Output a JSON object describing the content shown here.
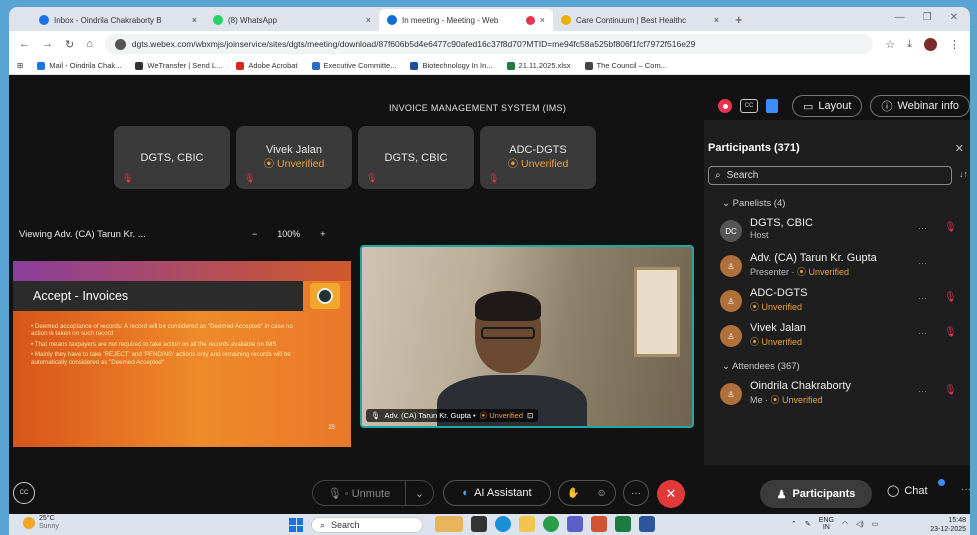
{
  "tabs": [
    {
      "label": "Inbox - Oindrila Chakraborty B",
      "close": "×",
      "icon_color": "#1a73e8",
      "active": false
    },
    {
      "label": "(8) WhatsApp",
      "close": "×",
      "icon_color": "#25d366",
      "active": false
    },
    {
      "label": "In meeting - Meeting - Web",
      "close": "×",
      "icon_color": "#0b6fd1",
      "active": true
    },
    {
      "label": "Care Continuum | Best Healthc",
      "close": "×",
      "icon_color": "#f0b000",
      "active": false
    }
  ],
  "new_tab": "+",
  "url": "dgts.webex.com/wbxmjs/joinservice/sites/dgts/meeting/download/87f606b5d4e6477c90afed16c37f8d70?MTID=me94fc58a525bf806f1fcf7972f516e29",
  "bookmarks": [
    {
      "label": "Mail - Oindrila Chak...",
      "color": "#1a73e8"
    },
    {
      "label": "WeTransfer | Send L...",
      "color": "#333333"
    },
    {
      "label": "Adobe Acrobat",
      "color": "#d7261e"
    },
    {
      "label": "Executive Committe...",
      "color": "#2b6cc4"
    },
    {
      "label": "Biotechnology In In...",
      "color": "#1a4fa0"
    },
    {
      "label": "21.11.2025.xlsx",
      "color": "#1d7a41"
    },
    {
      "label": "The Council – Com...",
      "color": "#444444"
    }
  ],
  "meeting": {
    "title": "INVOICE MANAGEMENT SYSTEM (IMS)",
    "layout_label": "Layout",
    "webinar_label": "Webinar info",
    "cc_label": "CC",
    "tiles": [
      {
        "name": "DGTS, CBIC",
        "status": ""
      },
      {
        "name": "Vivek Jalan",
        "status": "⦿ Unverified"
      },
      {
        "name": "DGTS, CBIC",
        "status": ""
      },
      {
        "name": "ADC-DGTS",
        "status": "⦿ Unverified"
      }
    ],
    "viewing_label": "Viewing Adv. (CA) Tarun Kr. ...",
    "zoom_minus": "−",
    "zoom_level": "100%",
    "zoom_plus": "+",
    "slide": {
      "heading": "Accept - Invoices",
      "bullets": [
        "• Deemed acceptance of records: A record will be considered as \"Deemed Accepted\" in case no action is taken on such record",
        "• That means taxpayers are not required to take action on all the records available on IMS",
        "• Mainly they have to take 'REJECT' and 'PENDING' actions only and remaining records will be automatically considered as \"Deemed Accepted\""
      ],
      "page": "25"
    },
    "video_label": "Adv. (CA) Tarun Kr. Gupta •",
    "video_status": "⦿ Unverified"
  },
  "participants": {
    "title": "Participants (371)",
    "search_placeholder": "Search",
    "panelists_label": "Panelists (4)",
    "attendees_label": "Attendees (367)",
    "people": [
      {
        "initials": "DC",
        "name": "DGTS, CBIC",
        "sub": "Host",
        "status": ""
      },
      {
        "initials": "",
        "name": "Adv. (CA) Tarun Kr. Gupta",
        "sub": "Presenter ·",
        "status": "⦿ Unverified"
      },
      {
        "initials": "",
        "name": "ADC-DGTS",
        "sub": "",
        "status": "⦿ Unverified"
      },
      {
        "initials": "",
        "name": "Vivek Jalan",
        "sub": "",
        "status": "⦿ Unverified"
      },
      {
        "initials": "",
        "name": "Oindrila Chakraborty",
        "sub": "Me ·",
        "status": "⦿ Unverified"
      }
    ]
  },
  "controls": {
    "unmute": "Unmute",
    "ai_assistant": "AI Assistant",
    "participants": "Participants",
    "chat": "Chat"
  },
  "taskbar": {
    "temp": "25°C",
    "weather": "Sunny",
    "search": "Search",
    "lang_top": "ENG",
    "lang_bottom": "IN",
    "time": "15:48",
    "date": "23-12-2025"
  }
}
